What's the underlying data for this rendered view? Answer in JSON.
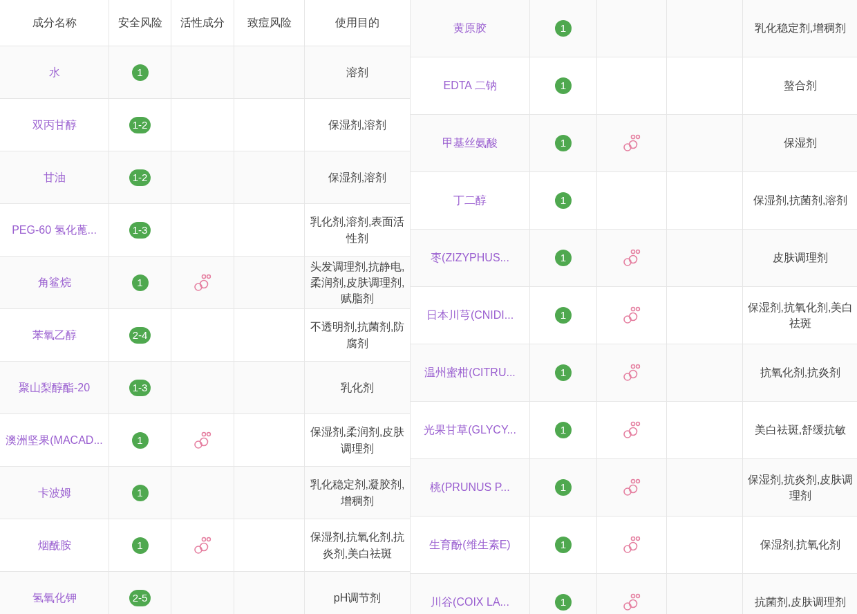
{
  "left_table": {
    "columns": [
      "成分名称",
      "安全风险",
      "活性成分",
      "致痘风险",
      "使用目的"
    ],
    "rows": [
      {
        "name": "水",
        "risk": "1",
        "active": false,
        "purpose": "溶剂"
      },
      {
        "name": "双丙甘醇",
        "risk": "1-2",
        "active": false,
        "purpose": "保湿剂,溶剂"
      },
      {
        "name": "甘油",
        "risk": "1-2",
        "active": false,
        "purpose": "保湿剂,溶剂"
      },
      {
        "name": "PEG-60 氢化蓖...",
        "risk": "1-3",
        "active": false,
        "purpose": "乳化剂,溶剂,表面活性剂"
      },
      {
        "name": "角鲨烷",
        "risk": "1",
        "active": true,
        "purpose": "头发调理剂,抗静电,柔润剂,皮肤调理剂,赋脂剂"
      },
      {
        "name": "苯氧乙醇",
        "risk": "2-4",
        "active": false,
        "purpose": "不透明剂,抗菌剂,防腐剂"
      },
      {
        "name": "聚山梨醇酯-20",
        "risk": "1-3",
        "active": false,
        "purpose": "乳化剂"
      },
      {
        "name": "澳洲坚果(MACAD...",
        "risk": "1",
        "active": true,
        "purpose": "保湿剂,柔润剂,皮肤调理剂"
      },
      {
        "name": "卡波姆",
        "risk": "1",
        "active": false,
        "purpose": "乳化稳定剂,凝胶剂,增稠剂"
      },
      {
        "name": "烟酰胺",
        "risk": "1",
        "active": true,
        "purpose": "保湿剂,抗氧化剂,抗炎剂,美白祛斑"
      },
      {
        "name": "氢氧化钾",
        "risk": "2-5",
        "active": false,
        "purpose": "pH调节剂"
      }
    ]
  },
  "right_table": {
    "rows": [
      {
        "name": "黄原胶",
        "risk": "1",
        "active": false,
        "purpose": "乳化稳定剂,增稠剂"
      },
      {
        "name": "EDTA 二钠",
        "risk": "1",
        "active": false,
        "purpose": "螯合剂"
      },
      {
        "name": "甲基丝氨酸",
        "risk": "1",
        "active": true,
        "purpose": "保湿剂"
      },
      {
        "name": "丁二醇",
        "risk": "1",
        "active": false,
        "purpose": "保湿剂,抗菌剂,溶剂"
      },
      {
        "name": "枣(ZIZYPHUS...",
        "risk": "1",
        "active": true,
        "purpose": "皮肤调理剂"
      },
      {
        "name": "日本川芎(CNIDI...",
        "risk": "1",
        "active": true,
        "purpose": "保湿剂,抗氧化剂,美白祛斑"
      },
      {
        "name": "温州蜜柑(CITRU...",
        "risk": "1",
        "active": true,
        "purpose": "抗氧化剂,抗炎剂"
      },
      {
        "name": "光果甘草(GLYCY...",
        "risk": "1",
        "active": true,
        "purpose": "美白祛斑,舒缓抗敏"
      },
      {
        "name": "桃(PRUNUS P...",
        "risk": "1",
        "active": true,
        "purpose": "保湿剂,抗炎剂,皮肤调理剂"
      },
      {
        "name": "生育酚(维生素E)",
        "risk": "1",
        "active": true,
        "purpose": "保湿剂,抗氧化剂"
      },
      {
        "name": "川谷(COIX LA...",
        "risk": "1",
        "active": true,
        "purpose": "抗菌剂,皮肤调理剂"
      }
    ]
  }
}
